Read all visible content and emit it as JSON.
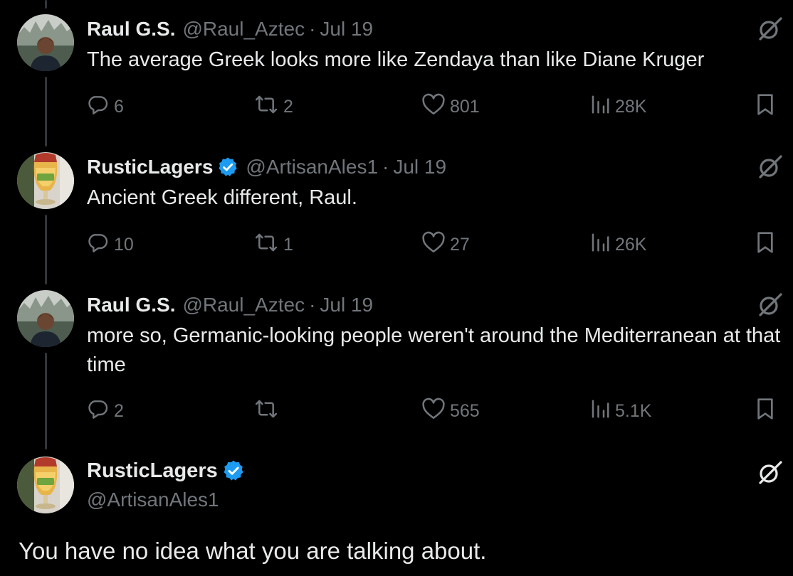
{
  "colors": {
    "background": "#000000",
    "text_primary": "#e7e9ea",
    "text_secondary": "#71767b",
    "verified_blue": "#1d9bf0",
    "thread_line": "#333639"
  },
  "replies": [
    {
      "display_name": "Raul G.S.",
      "handle": "@Raul_Aztec",
      "separator": "·",
      "date": "Jul 19",
      "verified": false,
      "text": "The average Greek looks more like Zendaya than like Diane Kruger",
      "stats": {
        "replies": "6",
        "reposts": "2",
        "likes": "801",
        "views": "28K"
      }
    },
    {
      "display_name": "RusticLagers",
      "handle": "@ArtisanAles1",
      "separator": "·",
      "date": "Jul 19",
      "verified": true,
      "text": "Ancient Greek different, Raul.",
      "stats": {
        "replies": "10",
        "reposts": "1",
        "likes": "27",
        "views": "26K"
      }
    },
    {
      "display_name": "Raul G.S.",
      "handle": "@Raul_Aztec",
      "separator": "·",
      "date": "Jul 19",
      "verified": false,
      "text": "more so, Germanic-looking people weren't around the Mediterranean at that time",
      "stats": {
        "replies": "2",
        "reposts": "",
        "likes": "565",
        "views": "5.1K"
      }
    }
  ],
  "main_tweet": {
    "display_name": "RusticLagers",
    "handle": "@ArtisanAles1",
    "verified": true,
    "text": "You have no idea what you are talking about."
  },
  "icons": {
    "reply": "reply-icon",
    "repost": "repost-icon",
    "like": "heart-icon",
    "views": "views-chart-icon",
    "bookmark": "bookmark-icon",
    "grok": "grok-icon",
    "verified": "verified-badge-icon"
  }
}
